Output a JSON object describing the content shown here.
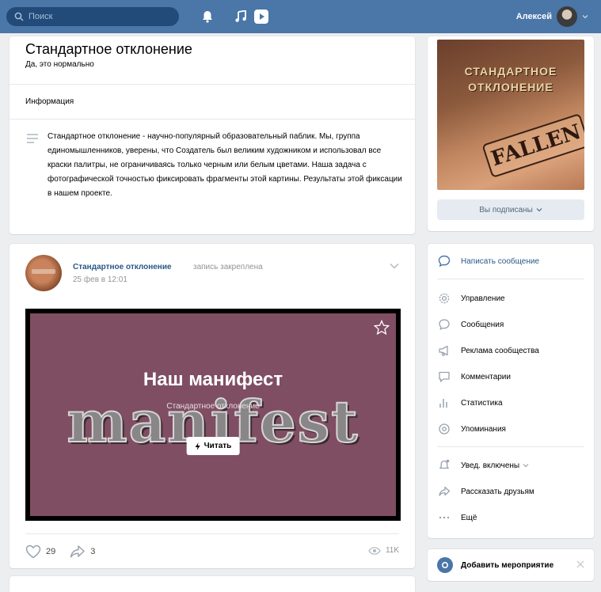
{
  "header": {
    "search_placeholder": "Поиск",
    "user_name": "Алексей",
    "icons": [
      "search-icon",
      "bell-icon",
      "music-icon",
      "play-icon",
      "chevron-down-icon"
    ],
    "bar_color": "#4a76a8"
  },
  "group_info": {
    "title": "Стандартное отклонение",
    "status": "Да, это нормально",
    "section_label": "Информация",
    "description": "Стандартное отклонение - научно-популярный образовательный паблик. Мы, группа единомышленников, уверены, что Создатель был великим художником и использовал все краски палитры, не ограничиваясь только черным или белым цветами. Наша задача с фотографической точностью фиксировать фрагменты этой картины. Результаты этой фиксации в нашем проекте."
  },
  "post": {
    "author": "Стандартное отклонение",
    "pinned_label": "запись закреплена",
    "date": "25 фев в 12:01",
    "banner": {
      "heading": "Наш манифест",
      "background_word": "manifest",
      "subtitle": "Стандартное отклонение",
      "read_button": "Читать",
      "bg_color": "#7f4e63"
    },
    "likes": "29",
    "shares": "3",
    "views": "11K"
  },
  "sidebar": {
    "cover_text_line1": "СТАНДАРТНОЕ",
    "cover_text_line2": "ОТКЛОНЕНИЕ",
    "cover_stamp": "FALLEN",
    "subscribed_button": "Вы подписаны",
    "menu": {
      "write_message": "Написать сообщение",
      "manage": "Управление",
      "messages": "Сообщения",
      "advertise": "Реклама сообщества",
      "comments": "Комментарии",
      "stats": "Статистика",
      "mentions": "Упоминания",
      "notifications": "Увед. включены",
      "tell_friends": "Рассказать друзьям",
      "more": "Ещё"
    },
    "add_event": "Добавить мероприятие",
    "accent_color": "#2a5885"
  }
}
